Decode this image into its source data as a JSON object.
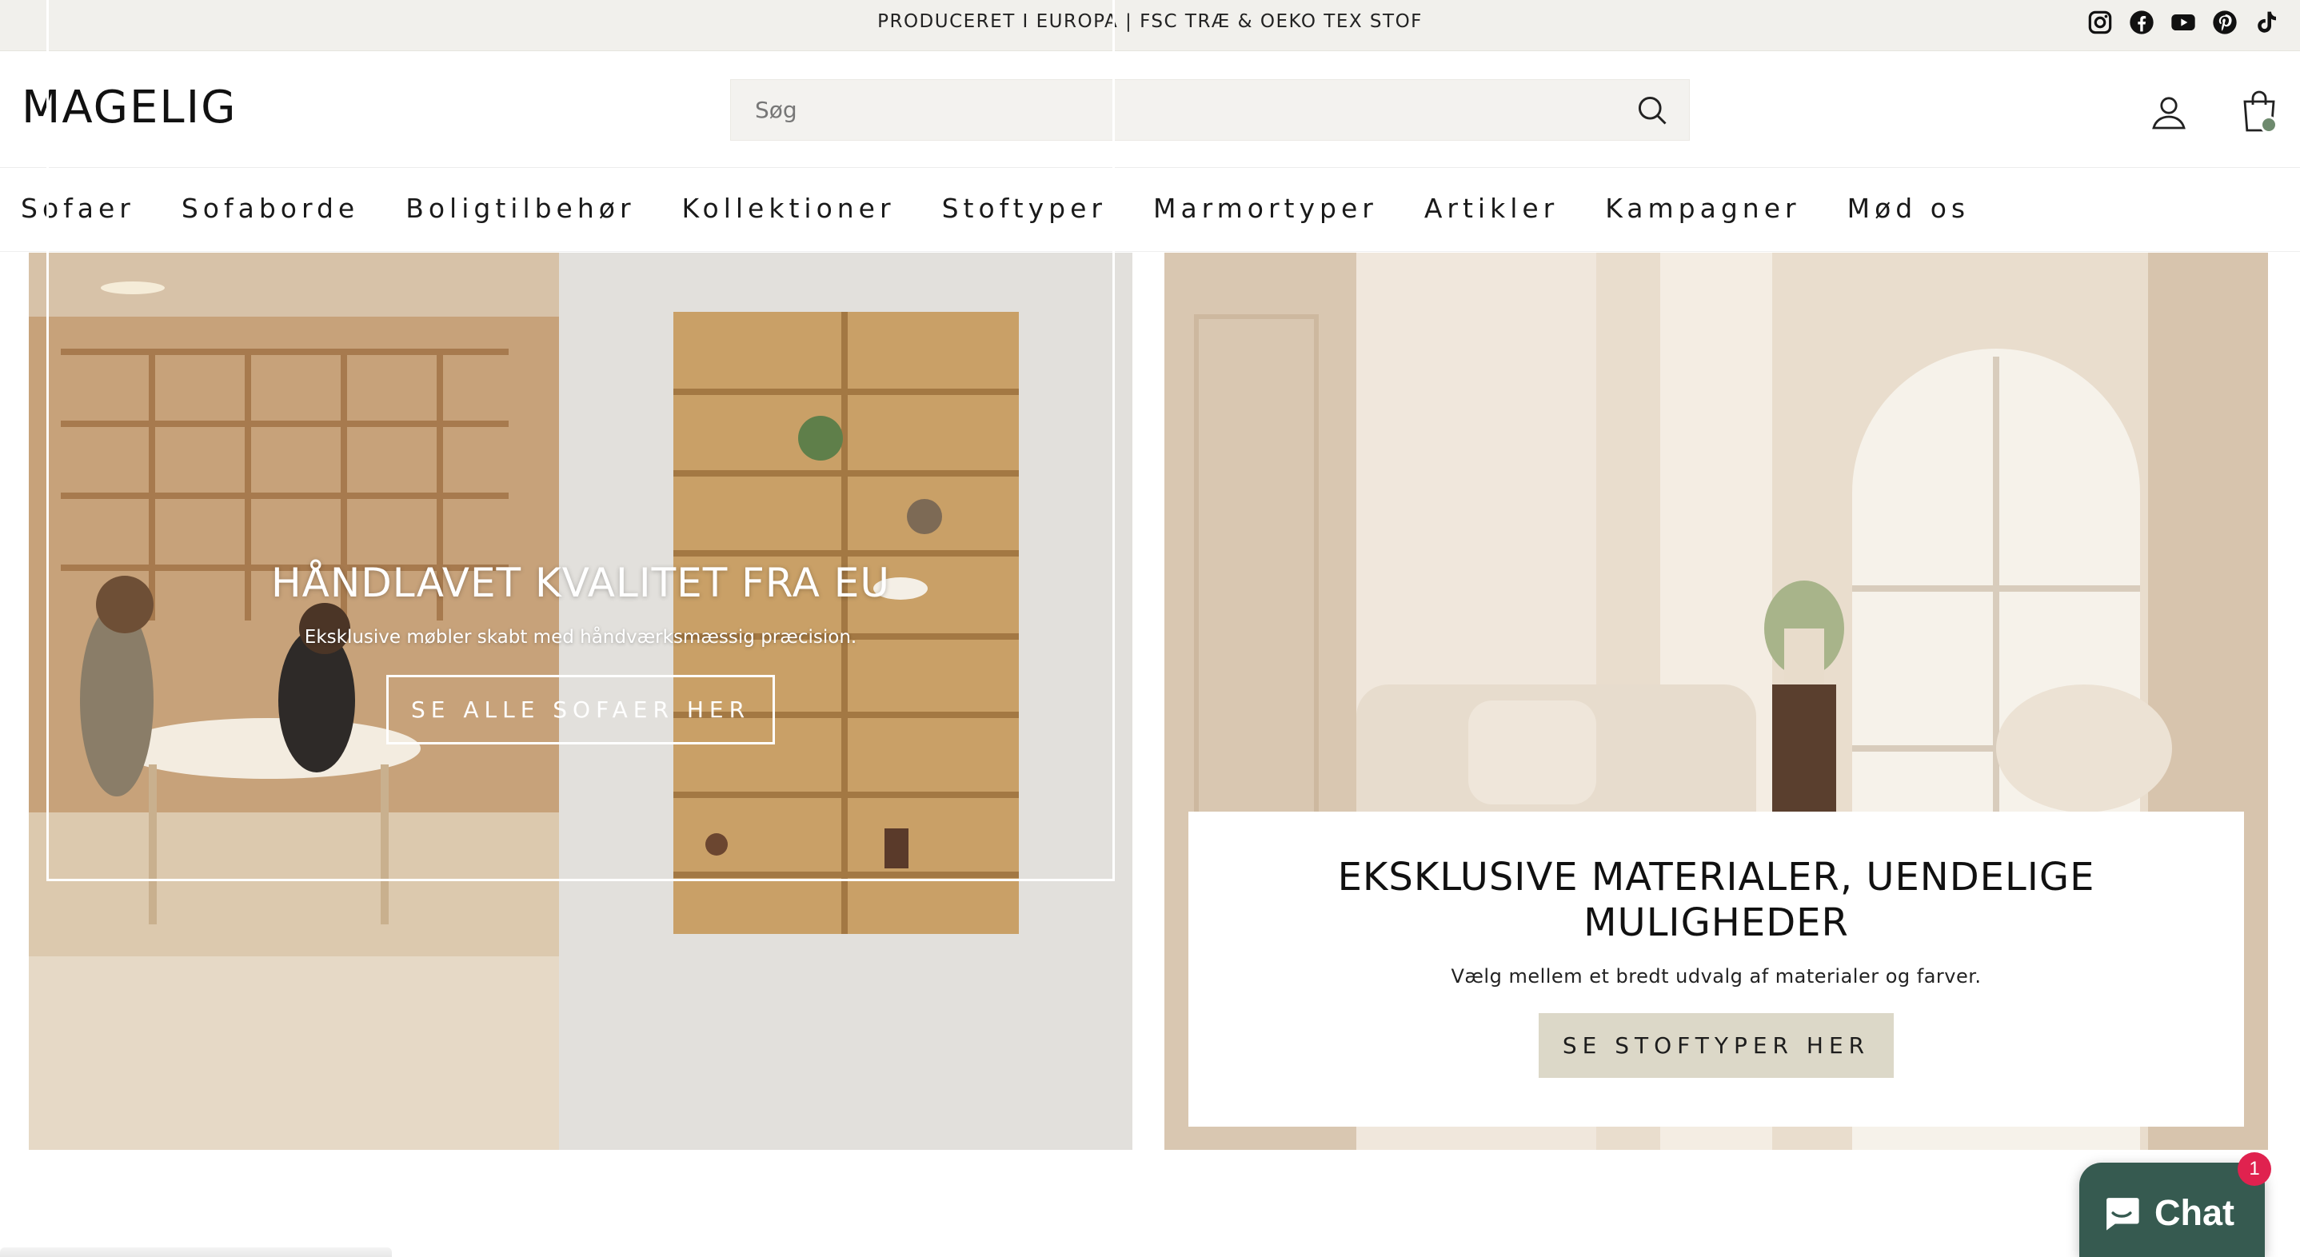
{
  "announcement": {
    "text": "PRODUCERET I EUROPA | FSC TRÆ & OEKO TEX STOF"
  },
  "social": [
    "instagram-icon",
    "facebook-icon",
    "youtube-icon",
    "pinterest-icon",
    "tiktok-icon"
  ],
  "header": {
    "logo": "MAGELIG",
    "search": {
      "placeholder": "Søg",
      "value": ""
    },
    "cart_badge_color": "#6e8a6e"
  },
  "nav": {
    "items": [
      {
        "label": "Sofaer"
      },
      {
        "label": "Sofaborde"
      },
      {
        "label": "Boligtilbehør"
      },
      {
        "label": "Kollektioner"
      },
      {
        "label": "Stoftyper"
      },
      {
        "label": "Marmortyper"
      },
      {
        "label": "Artikler"
      },
      {
        "label": "Kampagner"
      },
      {
        "label": "Mød os"
      }
    ]
  },
  "hero_left": {
    "title": "HÅNDLAVET KVALITET FRA EU",
    "subtitle": "Eksklusive møbler skabt med håndværksmæssig præcision.",
    "button": "SE ALLE SOFAER HER"
  },
  "hero_right": {
    "title": "EKSKLUSIVE MATERIALER, UENDELIGE MULIGHEDER",
    "subtitle": "Vælg mellem et bredt udvalg af materialer og farver.",
    "button": "SE STOFTYPER HER",
    "button_color": "#dcd8c8"
  },
  "chat": {
    "label": "Chat",
    "badge": "1",
    "color": "#365a50"
  }
}
